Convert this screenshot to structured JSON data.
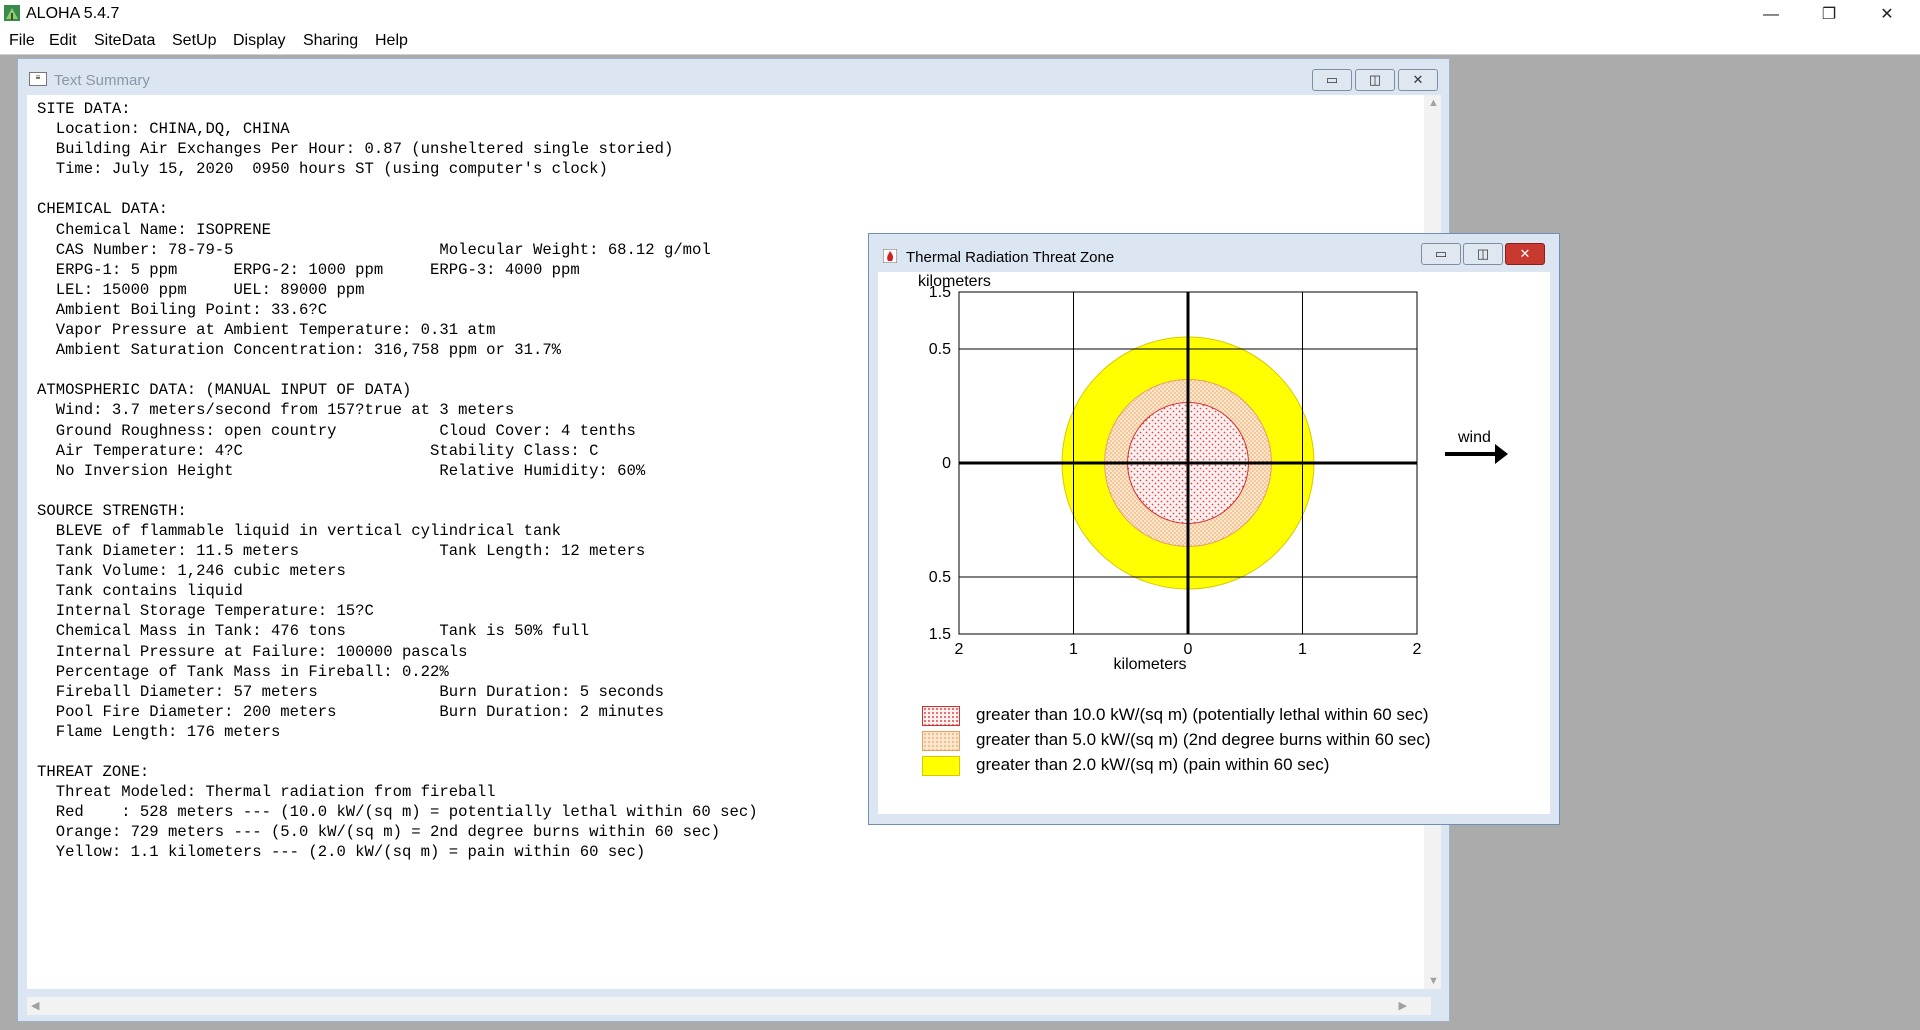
{
  "app": {
    "title": "ALOHA 5.4.7"
  },
  "window_controls": {
    "minimize": "—",
    "restore": "❐",
    "close": "✕"
  },
  "menu": [
    "File",
    "Edit",
    "SiteData",
    "SetUp",
    "Display",
    "Sharing",
    "Help"
  ],
  "text_summary": {
    "title": "Text Summary",
    "lines": [
      "SITE DATA:",
      "  Location: CHINA,DQ, CHINA",
      "  Building Air Exchanges Per Hour: 0.87 (unsheltered single storied)",
      "  Time: July 15, 2020  0950 hours ST (using computer's clock)",
      "",
      "CHEMICAL DATA:",
      "  Chemical Name: ISOPRENE",
      "  CAS Number: 78-79-5                      Molecular Weight: 68.12 g/mol",
      "  ERPG-1: 5 ppm      ERPG-2: 1000 ppm     ERPG-3: 4000 ppm",
      "  LEL: 15000 ppm     UEL: 89000 ppm",
      "  Ambient Boiling Point: 33.6?C",
      "  Vapor Pressure at Ambient Temperature: 0.31 atm",
      "  Ambient Saturation Concentration: 316,758 ppm or 31.7%",
      "",
      "ATMOSPHERIC DATA: (MANUAL INPUT OF DATA)",
      "  Wind: 3.7 meters/second from 157?true at 3 meters",
      "  Ground Roughness: open country           Cloud Cover: 4 tenths",
      "  Air Temperature: 4?C                    Stability Class: C",
      "  No Inversion Height                      Relative Humidity: 60%",
      "",
      "SOURCE STRENGTH:",
      "  BLEVE of flammable liquid in vertical cylindrical tank",
      "  Tank Diameter: 11.5 meters               Tank Length: 12 meters",
      "  Tank Volume: 1,246 cubic meters",
      "  Tank contains liquid",
      "  Internal Storage Temperature: 15?C",
      "  Chemical Mass in Tank: 476 tons          Tank is 50% full",
      "  Internal Pressure at Failure: 100000 pascals",
      "  Percentage of Tank Mass in Fireball: 0.22%",
      "  Fireball Diameter: 57 meters             Burn Duration: 5 seconds",
      "  Pool Fire Diameter: 200 meters           Burn Duration: 2 minutes",
      "  Flame Length: 176 meters",
      "",
      "THREAT ZONE:",
      "  Threat Modeled: Thermal radiation from fireball",
      "  Red    : 528 meters --- (10.0 kW/(sq m) = potentially lethal within 60 sec)",
      "  Orange: 729 meters --- (5.0 kW/(sq m) = 2nd degree burns within 60 sec)",
      "  Yellow: 1.1 kilometers --- (2.0 kW/(sq m) = pain within 60 sec)"
    ]
  },
  "threat_window": {
    "title": "Thermal Radiation Threat Zone",
    "wind_label": "wind"
  },
  "chart_data": {
    "type": "threat-zone-circles",
    "ylabel": "kilometers",
    "xlabel": "kilometers",
    "x_ticks": [
      "2",
      "1",
      "0",
      "1",
      "2"
    ],
    "y_ticks": [
      "1.5",
      "0.5",
      "0",
      "0.5",
      "1.5"
    ],
    "xlim": [
      -2,
      2
    ],
    "ylim": [
      -1.5,
      1.5
    ],
    "zones": [
      {
        "radius_km": 1.1,
        "color": "#ffff00",
        "pattern": "solid",
        "label": "greater than 2.0 kW/(sq m) (pain within 60 sec)"
      },
      {
        "radius_km": 0.729,
        "color": "#f4c08a",
        "pattern": "dots",
        "label": "greater than 5.0 kW/(sq m) (2nd degree burns within 60 sec)"
      },
      {
        "radius_km": 0.528,
        "color": "#e8464a",
        "pattern": "dots",
        "label": "greater than 10.0 kW/(sq m) (potentially lethal within 60 sec)"
      }
    ],
    "legend_order": [
      2,
      1,
      0
    ]
  }
}
